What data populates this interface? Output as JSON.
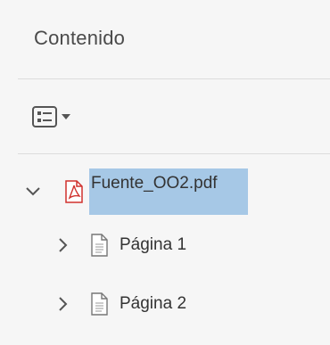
{
  "panel": {
    "title": "Contenido"
  },
  "toolbar": {
    "options_icon": "list-options-icon",
    "caret_icon": "caret-down-icon"
  },
  "tree": {
    "root": {
      "label": "Fuente_OO2.pdf",
      "icon": "pdf-file-icon",
      "expanded": true,
      "selected": true
    },
    "children": [
      {
        "label": "Página 1",
        "icon": "page-icon",
        "expanded": false
      },
      {
        "label": "Página 2",
        "icon": "page-icon",
        "expanded": false
      }
    ]
  },
  "colors": {
    "background": "#f6f6f6",
    "selection": "#a6c8e6",
    "pdf_red": "#d0312d",
    "text": "#333333"
  }
}
